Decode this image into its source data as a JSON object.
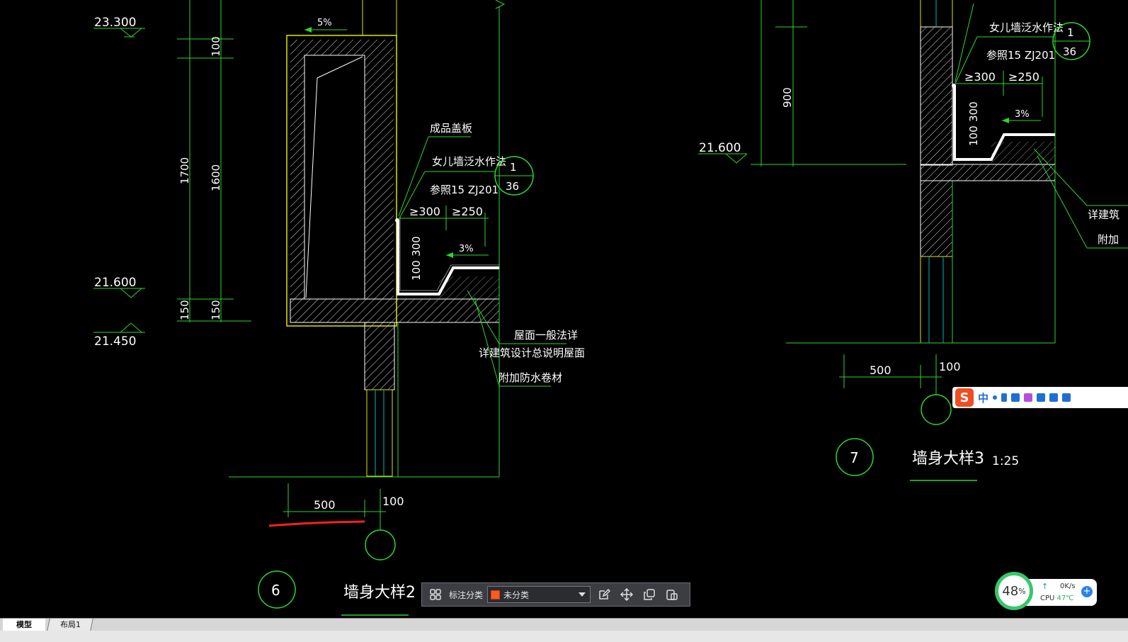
{
  "drawing": {
    "detail2": {
      "elev_top": "23.300",
      "elev_mid": "21.600",
      "elev_low": "21.450",
      "slope_top": "5%",
      "dims": [
        "1700",
        "100",
        "1600",
        "150",
        "150"
      ],
      "note_cover": "成品盖板",
      "note_parapet": "女儿墙泛水作法",
      "note_ref": "参照15 ZJ201",
      "ref_num": "1",
      "ref_page": "36",
      "dim_ge300": "≥300",
      "dim_ge250": "≥250",
      "dim_300": "300",
      "dim_100": "100",
      "slope": "3%",
      "note_roof1": "屋面一般法详",
      "note_roof2": "详建筑设计总说明屋面",
      "note_roof3": "附加防水卷材",
      "dim_500": "500",
      "dim_100b": "100",
      "detail_no": "6",
      "title": "墙身大样2"
    },
    "detail3": {
      "elev_mid": "21.600",
      "dim_900": "900",
      "note_parapet": "女儿墙泛水作法",
      "note_ref": "参照15 ZJ201",
      "ref_num": "1",
      "ref_page": "36",
      "dim_ge300": "≥300",
      "dim_ge250": "≥250",
      "dim_300": "300",
      "dim_100": "100",
      "slope": "3%",
      "note_cut1": "详建筑",
      "note_cut2": "附加",
      "dim_500": "500",
      "dim_100b": "100",
      "detail_no": "7",
      "title": "墙身大样3",
      "scale": "1:25"
    }
  },
  "toolbar": {
    "category_label": "标注分类",
    "category_value": "未分类",
    "icons": [
      "grid-icon",
      "edit-icon",
      "move-icon",
      "copy-icon",
      "paste-icon"
    ]
  },
  "tabs": {
    "model": "模型",
    "layout1": "布局1"
  },
  "ime": {
    "lang": "中",
    "logo": "S"
  },
  "perf": {
    "percent": "48",
    "percent_unit": "%",
    "net": "0K/s",
    "cpu_label": "CPU",
    "cpu_temp": "47℃",
    "plus": "+"
  },
  "colors": {
    "cad_green": "#2fd52f",
    "cad_yellow": "#e4e400",
    "cad_white": "#ffffff",
    "cad_cyan": "#00b8b8",
    "cad_red": "#ff2020"
  }
}
